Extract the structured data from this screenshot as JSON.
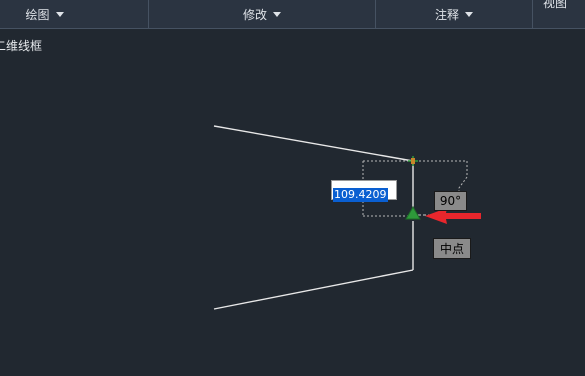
{
  "ribbon": {
    "panels": [
      {
        "label": "绘图"
      },
      {
        "label": "修改"
      },
      {
        "label": "注释"
      }
    ],
    "cut_panel_label": "视图"
  },
  "viewport": {
    "label": "二维线框"
  },
  "dynamic_input": {
    "value": "109.4209"
  },
  "tooltips": {
    "angle": "90°",
    "snap": "中点"
  },
  "colors": {
    "background": "#212830",
    "ribbon": "#2b3441",
    "line": "#e8e8e8",
    "snap_marker": "#2e9a3a",
    "pointer_arrow": "#e8262c",
    "selection": "#0a5fd1"
  },
  "icons": {
    "snap_marker": "midpoint-triangle-icon",
    "pointer": "red-arrow-icon"
  }
}
